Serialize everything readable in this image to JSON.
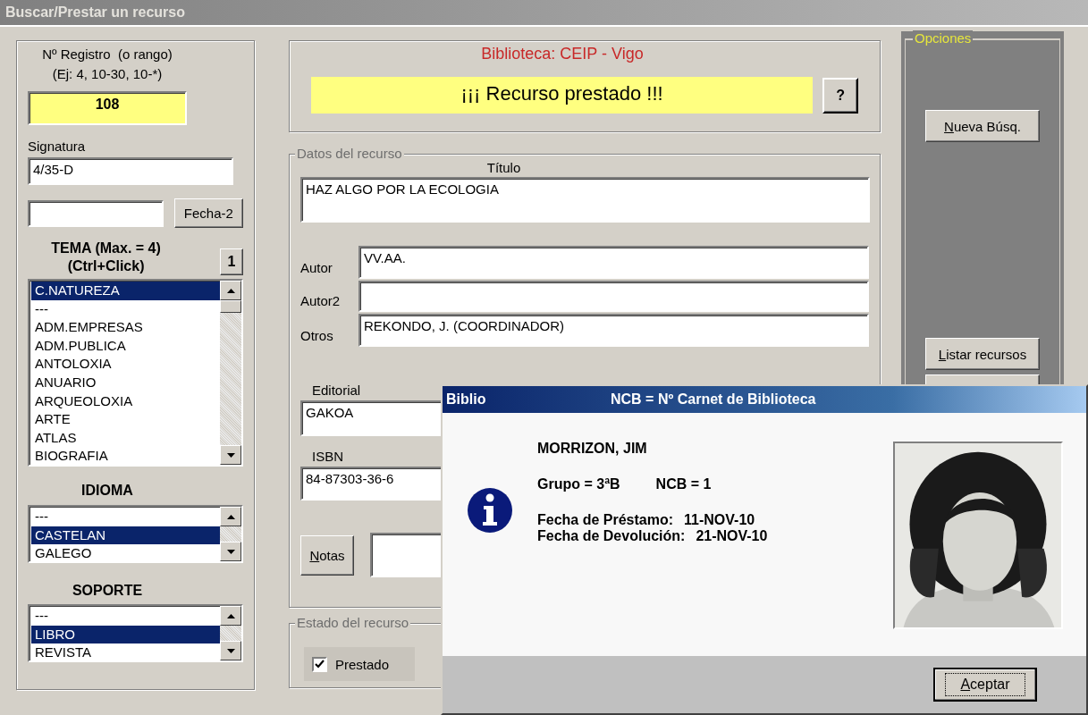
{
  "window": {
    "title": "Buscar/Prestar un recurso"
  },
  "registro": {
    "label": "Nº Registro  (o rango)",
    "hint": "(Ej: 4, 10-30, 10-*)",
    "value": "108"
  },
  "signatura": {
    "label": "Signatura",
    "value": "4/35-D"
  },
  "fecha": {
    "button": "Fecha-2"
  },
  "tema": {
    "title": "TEMA (Max. = 4)",
    "subtitle": "(Ctrl+Click)",
    "button": "1",
    "items": [
      {
        "label": "C.NATUREZA",
        "selected": true
      },
      {
        "label": "---",
        "selected": false
      },
      {
        "label": "ADM.EMPRESAS",
        "selected": false
      },
      {
        "label": "ADM.PUBLICA",
        "selected": false
      },
      {
        "label": "ANTOLOXIA",
        "selected": false
      },
      {
        "label": "ANUARIO",
        "selected": false
      },
      {
        "label": "ARQUEOLOXIA",
        "selected": false
      },
      {
        "label": "ARTE",
        "selected": false
      },
      {
        "label": "ATLAS",
        "selected": false
      },
      {
        "label": "BIOGRAFIA",
        "selected": false
      }
    ]
  },
  "idioma": {
    "title": "IDIOMA",
    "items": [
      {
        "label": "---",
        "selected": false
      },
      {
        "label": "CASTELAN",
        "selected": true
      },
      {
        "label": "GALEGO",
        "selected": false
      }
    ]
  },
  "soporte": {
    "title": "SOPORTE",
    "items": [
      {
        "label": "---",
        "selected": false
      },
      {
        "label": "LIBRO",
        "selected": true
      },
      {
        "label": "REVISTA",
        "selected": false
      }
    ]
  },
  "header": {
    "library": "Biblioteca: CEIP - Vigo",
    "status": "¡¡¡ Recurso prestado !!!",
    "help_button": "?"
  },
  "datos": {
    "legend": "Datos del recurso",
    "titulo_label": "Título",
    "titulo": "HAZ ALGO POR LA ECOLOGIA",
    "authors": [
      {
        "label": "Autor",
        "value": "VV.AA."
      },
      {
        "label": "Autor2"
      },
      {
        "label": "Otros",
        "value": "REKONDO, J. (COORDINADOR)"
      }
    ],
    "editorial_label": "Editorial",
    "editorial": "GAKOA",
    "isbn_label": "ISBN",
    "isbn": "84-87303-36-6",
    "notas_button": "Notas"
  },
  "estado": {
    "legend": "Estado del recurso",
    "prestado": {
      "label": "Prestado",
      "checked": true
    }
  },
  "opciones": {
    "legend": "Opciones",
    "buttons": [
      {
        "label": "Nueva Búsq."
      },
      {
        "label": "Listar recursos"
      }
    ]
  },
  "dialog": {
    "title": "Biblio",
    "caption": "NCB = Nº Carnet de Biblioteca",
    "name": "MORRIZON, JIM",
    "group": "Grupo = 3ªB",
    "ncb": "NCB = 1",
    "dates": [
      {
        "label": "Fecha de Préstamo:",
        "value": "11-NOV-10"
      },
      {
        "label": "Fecha de Devolución:",
        "value": "21-NOV-10"
      }
    ],
    "button": "Aceptar"
  }
}
